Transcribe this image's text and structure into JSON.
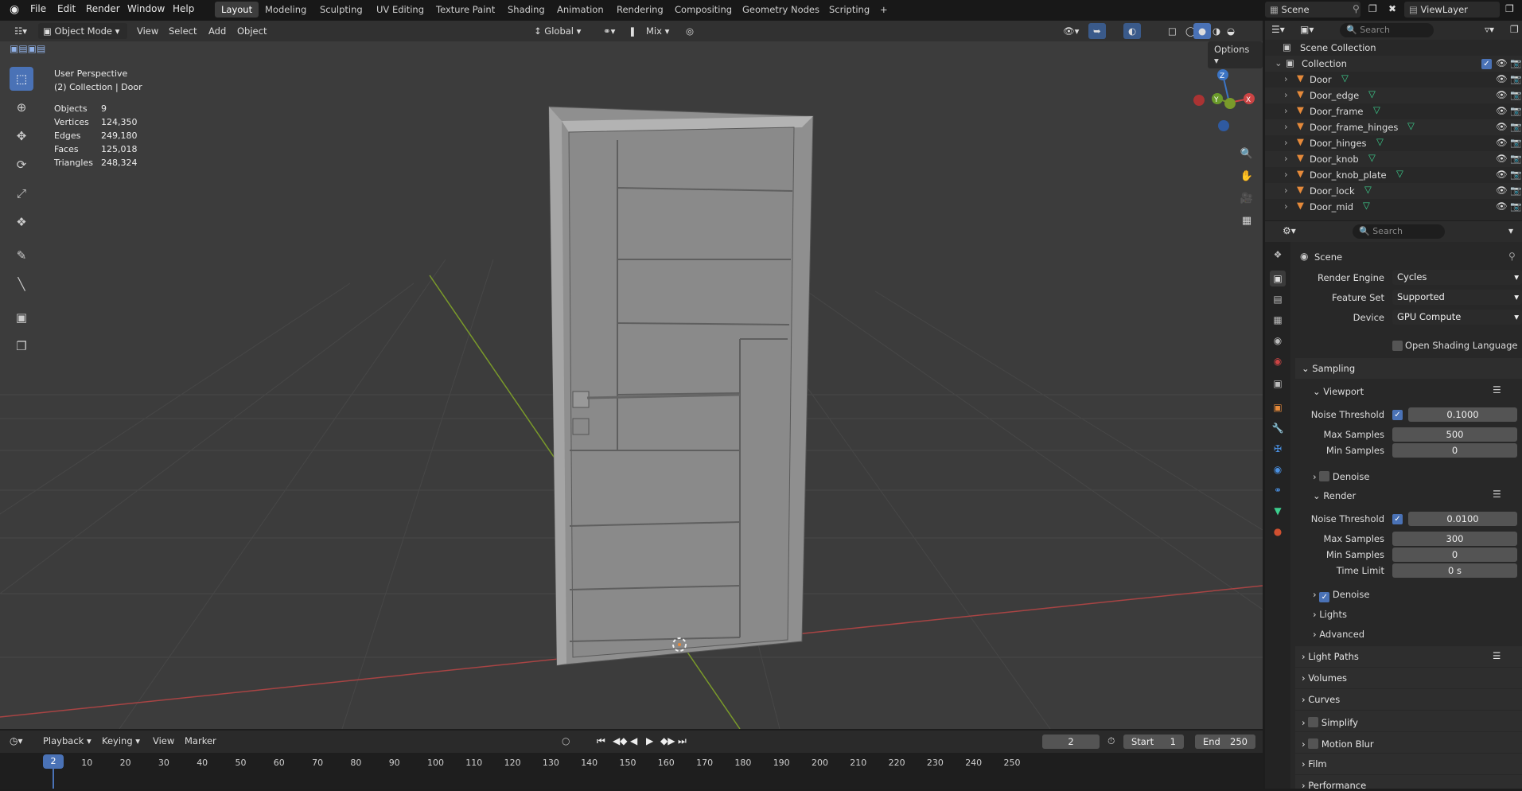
{
  "menus": [
    "File",
    "Edit",
    "Render",
    "Window",
    "Help"
  ],
  "workspaces": [
    "Layout",
    "Modeling",
    "Sculpting",
    "UV Editing",
    "Texture Paint",
    "Shading",
    "Animation",
    "Rendering",
    "Compositing",
    "Geometry Nodes",
    "Scripting",
    "+"
  ],
  "scene": "Scene",
  "view_layer": "ViewLayer",
  "viewport": {
    "mode": "Object Mode",
    "menus": [
      "View",
      "Select",
      "Add",
      "Object"
    ],
    "transform": "Global",
    "snap": "Mix",
    "options": "Options",
    "perspective": "User Perspective",
    "collection_label": "(2) Collection | Door",
    "stats": [
      {
        "label": "Objects",
        "value": "9"
      },
      {
        "label": "Vertices",
        "value": "124,350"
      },
      {
        "label": "Edges",
        "value": "249,180"
      },
      {
        "label": "Faces",
        "value": "125,018"
      },
      {
        "label": "Triangles",
        "value": "248,324"
      }
    ],
    "gizmo": {
      "z": "Z",
      "y": "Y",
      "x": "X"
    }
  },
  "outliner": {
    "search_placeholder": "Search",
    "scene_collection": "Scene Collection",
    "collection": "Collection",
    "objects": [
      "Door",
      "Door_edge",
      "Door_frame",
      "Door_frame_hinges",
      "Door_hinges",
      "Door_knob",
      "Door_knob_plate",
      "Door_lock",
      "Door_mid"
    ]
  },
  "properties": {
    "search_placeholder": "Search",
    "context": "Scene",
    "render_engine_label": "Render Engine",
    "render_engine": "Cycles",
    "feature_set_label": "Feature Set",
    "feature_set": "Supported",
    "device_label": "Device",
    "device": "GPU Compute",
    "osl": "Open Shading Language",
    "sampling": "Sampling",
    "viewport": "Viewport",
    "noise_threshold_label": "Noise Threshold",
    "vp_noise": "0.1000",
    "max_samples_label": "Max Samples",
    "vp_max": "500",
    "min_samples_label": "Min Samples",
    "vp_min": "0",
    "denoise": "Denoise",
    "render": "Render",
    "r_noise": "0.0100",
    "r_max": "300",
    "r_min": "0",
    "time_limit_label": "Time Limit",
    "time_limit": "0 s",
    "lights": "Lights",
    "advanced": "Advanced",
    "panels": [
      "Light Paths",
      "Volumes",
      "Curves",
      "Simplify",
      "Motion Blur",
      "Film",
      "Performance"
    ]
  },
  "timeline": {
    "menus": [
      "Playback",
      "Keying",
      "View",
      "Marker"
    ],
    "current_frame": "2",
    "start_label": "Start",
    "start": "1",
    "end_label": "End",
    "end": "250",
    "ticks": [
      "2",
      "10",
      "20",
      "30",
      "40",
      "50",
      "60",
      "70",
      "80",
      "90",
      "100",
      "110",
      "120",
      "130",
      "140",
      "150",
      "160",
      "170",
      "180",
      "190",
      "200",
      "210",
      "220",
      "230",
      "240",
      "250"
    ]
  }
}
